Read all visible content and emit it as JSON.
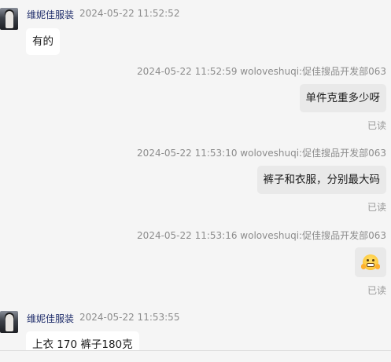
{
  "messages": [
    {
      "direction": "in",
      "sender": "维妮佳服装",
      "time": "2024-05-22 11:52:52",
      "text": "有的"
    },
    {
      "direction": "out",
      "meta": "2024-05-22 11:52:59   woloveshuqi:促佳搜品开发部063",
      "text": "单件克重多少呀",
      "status": "已读"
    },
    {
      "direction": "out",
      "meta": "2024-05-22 11:53:10   woloveshuqi:促佳搜品开发部063",
      "text": "裤子和衣服，分别最大码",
      "status": "已读"
    },
    {
      "direction": "out",
      "meta": "2024-05-22 11:53:16   woloveshuqi:促佳搜品开发部063",
      "emoji": "hand-over-mouth-emoji",
      "status": "已读"
    },
    {
      "direction": "in",
      "sender": "维妮佳服装",
      "time": "2024-05-22 11:53:55",
      "text": "上衣 170   裤子180克"
    }
  ],
  "colors": {
    "background": "#f5f5f5",
    "incoming_bubble": "#ffffff",
    "outgoing_bubble": "#e9e9e9",
    "sender_name": "#1f2d6b",
    "meta_text": "#8c8c8c"
  }
}
